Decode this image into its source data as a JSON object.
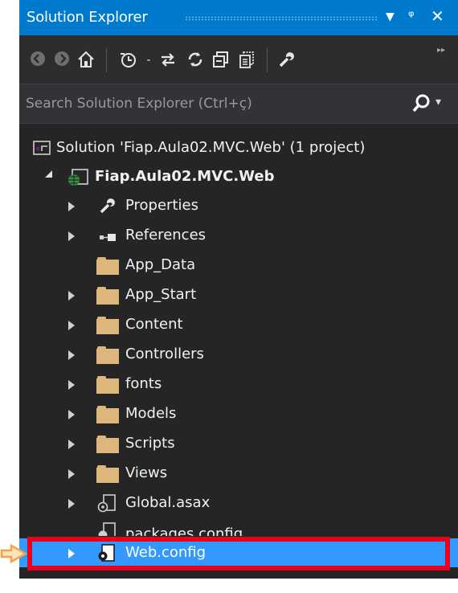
{
  "window": {
    "title": "Solution Explorer",
    "controls": [
      "dropdown-icon",
      "pin-icon",
      "close-icon"
    ]
  },
  "toolbar": {
    "buttons": [
      {
        "name": "back-icon",
        "glyph": "◉",
        "enabled": false
      },
      {
        "name": "forward-icon",
        "glyph": "◉",
        "enabled": false
      },
      {
        "name": "home-icon",
        "glyph": "⌂",
        "enabled": true
      },
      {
        "name": "pending-changes-icon",
        "glyph": "↺",
        "enabled": true
      },
      {
        "name": "sync-icon",
        "glyph": "⇄",
        "enabled": true
      },
      {
        "name": "refresh-icon",
        "glyph": "↻",
        "enabled": true
      },
      {
        "name": "collapse-all-icon",
        "glyph": "▣",
        "enabled": true
      },
      {
        "name": "show-all-files-icon",
        "glyph": "▤",
        "enabled": true
      },
      {
        "name": "properties-icon",
        "glyph": "🔧",
        "enabled": true
      }
    ]
  },
  "search": {
    "placeholder": "Search Solution Explorer (Ctrl+ç)"
  },
  "tree": {
    "solution_label": "Solution 'Fiap.Aula02.MVC.Web' (1 project)",
    "project_label": "Fiap.Aula02.MVC.Web",
    "items": [
      {
        "label": "Properties",
        "icon": "wrench-icon",
        "expandable": true
      },
      {
        "label": "References",
        "icon": "references-icon",
        "expandable": true
      },
      {
        "label": "App_Data",
        "icon": "folder-icon",
        "expandable": false
      },
      {
        "label": "App_Start",
        "icon": "folder-icon",
        "expandable": true
      },
      {
        "label": "Content",
        "icon": "folder-icon",
        "expandable": true
      },
      {
        "label": "Controllers",
        "icon": "folder-icon",
        "expandable": true
      },
      {
        "label": "fonts",
        "icon": "folder-icon",
        "expandable": true
      },
      {
        "label": "Models",
        "icon": "folder-icon",
        "expandable": true
      },
      {
        "label": "Scripts",
        "icon": "folder-icon",
        "expandable": true
      },
      {
        "label": "Views",
        "icon": "folder-icon",
        "expandable": true
      },
      {
        "label": "Global.asax",
        "icon": "asax-file-icon",
        "expandable": true
      },
      {
        "label": "packages.config",
        "icon": "config-file-icon",
        "expandable": false
      },
      {
        "label": "Web.config",
        "icon": "config-file-icon",
        "expandable": true,
        "selected": true
      }
    ]
  },
  "colors": {
    "titlebar": "#007acc",
    "panel": "#252526",
    "selection": "#3399ff",
    "highlight_box": "#e8001c",
    "arrow": "#f5a04a",
    "folder": "#dcb67a"
  }
}
